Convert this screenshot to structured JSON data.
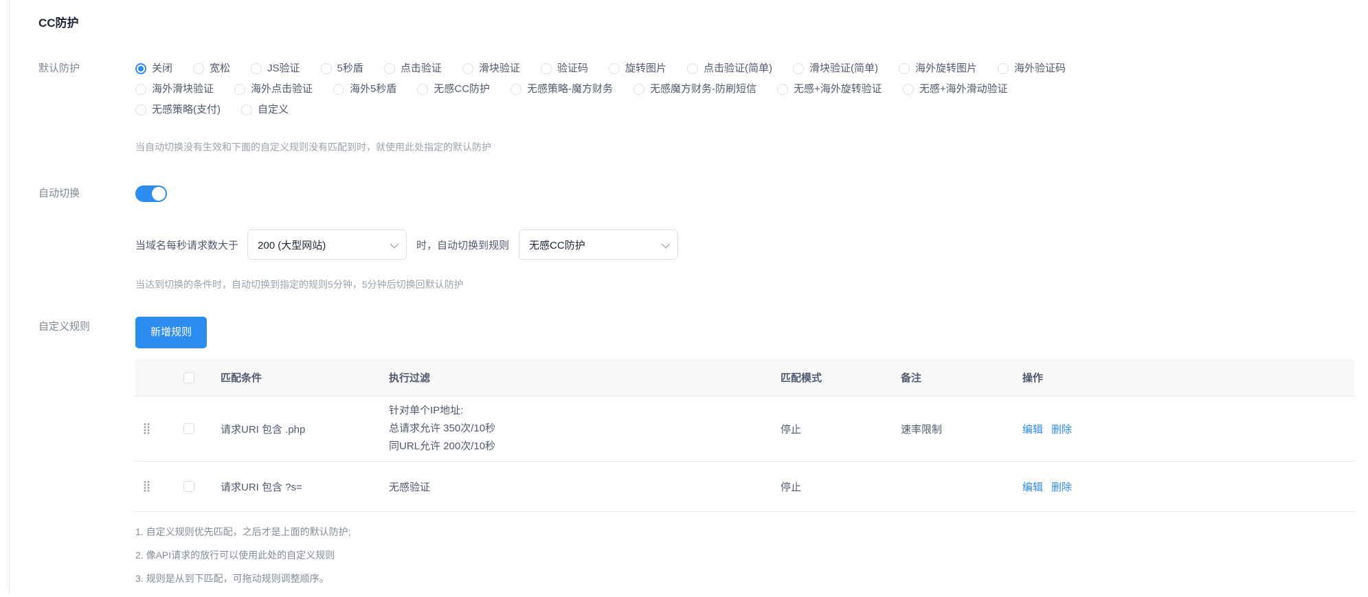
{
  "page": {
    "title": "CC防护"
  },
  "theme": {
    "accent_color": "#2d8cf0",
    "table_header_bg": "#f8f8f9"
  },
  "default_protection": {
    "label": "默认防护",
    "selected": "关闭",
    "options": [
      "关闭",
      "宽松",
      "JS验证",
      "5秒盾",
      "点击验证",
      "滑块验证",
      "验证码",
      "旋转图片",
      "点击验证(简单)",
      "滑块验证(简单)",
      "海外旋转图片",
      "海外验证码",
      "海外滑块验证",
      "海外点击验证",
      "海外5秒盾",
      "无感CC防护",
      "无感策略-魔方财务",
      "无感魔方财务-防刷短信",
      "无感+海外旋转验证",
      "无感+海外滑动验证",
      "无感策略(支付)",
      "自定义"
    ],
    "help": "当自动切换没有生效和下面的自定义规则没有匹配到时，就使用此处指定的默认防护"
  },
  "auto_switch": {
    "label": "自动切换",
    "enabled": true,
    "condition_prefix": "当域名每秒请求数大于",
    "threshold_value": "200 (大型网站)",
    "condition_middle": "时，自动切换到规则",
    "rule_value": "无感CC防护",
    "help": "当达到切换的条件时，自动切换到指定的规则5分钟，5分钟后切换回默认防护"
  },
  "custom_rules": {
    "label": "自定义规则",
    "add_button": "新增规则",
    "table": {
      "headers": {
        "condition": "匹配条件",
        "filter": "执行过滤",
        "mode": "匹配模式",
        "remark": "备注",
        "actions": "操作"
      },
      "rows": [
        {
          "condition": "请求URI 包含 .php",
          "filter_lines": [
            "针对单个IP地址:",
            "总请求允许 350次/10秒",
            "同URL允许 200次/10秒"
          ],
          "mode": "停止",
          "remark": "速率限制",
          "actions": [
            "编辑",
            "删除"
          ]
        },
        {
          "condition": "请求URI 包含 ?s=",
          "filter_lines": [
            "无感验证"
          ],
          "mode": "停止",
          "remark": "",
          "actions": [
            "编辑",
            "删除"
          ]
        }
      ]
    },
    "notes": [
      "1. 自定义规则优先匹配，之后才是上面的默认防护;",
      "2. 像API请求的放行可以使用此处的自定义规则",
      "3. 规则是从到下匹配，可拖动规则调整顺序。"
    ]
  }
}
